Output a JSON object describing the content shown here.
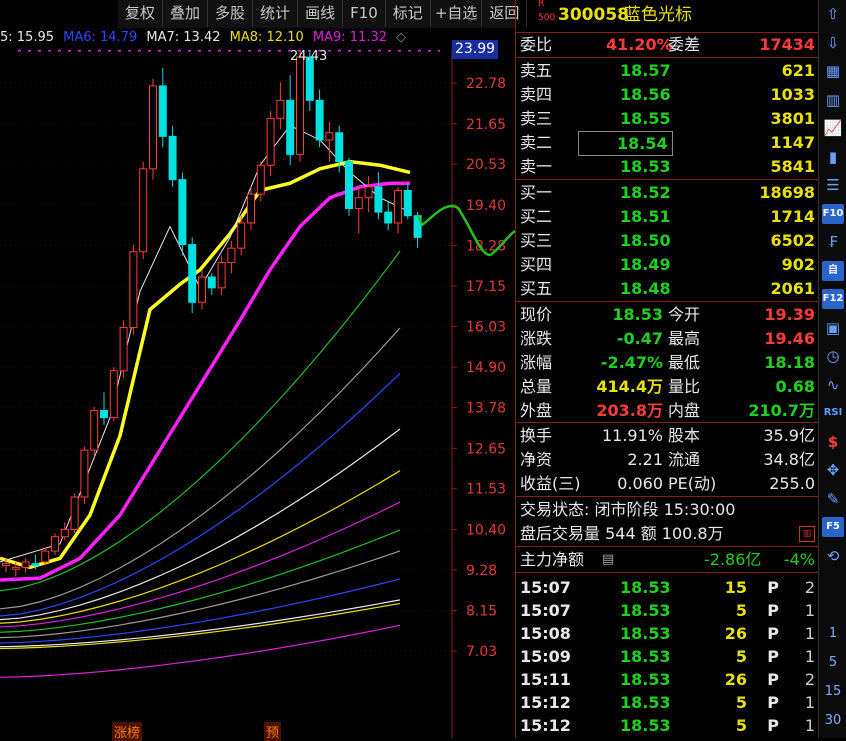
{
  "toolbar": {
    "items": [
      "复权",
      "叠加",
      "多股",
      "统计",
      "画线",
      "F10",
      "标记",
      "+自选",
      "返回"
    ]
  },
  "ma_legend": [
    {
      "label": "5: 15.95",
      "color": "#e8e8e8"
    },
    {
      "label": "MA6: 14.79",
      "color": "#2a48ff"
    },
    {
      "label": "MA7: 13.42",
      "color": "#e8e8e8"
    },
    {
      "label": "MA8: 12.10",
      "color": "#e8e000"
    },
    {
      "label": "MA9: 11.32",
      "color": "#e020e0"
    }
  ],
  "chart_data": {
    "type": "candlestick",
    "price_ticks": [
      "22.78",
      "21.65",
      "20.53",
      "19.40",
      "18.28",
      "17.15",
      "16.03",
      "14.90",
      "13.78",
      "12.65",
      "11.53",
      "10.40",
      "9.28",
      "8.15",
      "7.03"
    ],
    "current_price_tag": "23.99",
    "high_label": "24.43",
    "bottom_markers": [
      "涨榜",
      "预"
    ]
  },
  "stock": {
    "r_badge": "R",
    "market_code": "500",
    "code": "300058",
    "name": "蓝色光标"
  },
  "weibi": {
    "label1": "委比",
    "val1": "41.20%",
    "label2": "委差",
    "val2": "17434"
  },
  "sell": [
    {
      "label": "卖五",
      "price": "18.57",
      "vol": "621"
    },
    {
      "label": "卖四",
      "price": "18.56",
      "vol": "1033"
    },
    {
      "label": "卖三",
      "price": "18.55",
      "vol": "3801"
    },
    {
      "label": "卖二",
      "price": "18.54",
      "vol": "1147"
    },
    {
      "label": "卖一",
      "price": "18.53",
      "vol": "5841"
    }
  ],
  "buy": [
    {
      "label": "买一",
      "price": "18.52",
      "vol": "18698"
    },
    {
      "label": "买二",
      "price": "18.51",
      "vol": "1714"
    },
    {
      "label": "买三",
      "price": "18.50",
      "vol": "6502"
    },
    {
      "label": "买四",
      "price": "18.49",
      "vol": "902"
    },
    {
      "label": "买五",
      "price": "18.48",
      "vol": "2061"
    }
  ],
  "stats": [
    {
      "l1": "现价",
      "v1": "18.53",
      "c1": "green",
      "l2": "今开",
      "v2": "19.39",
      "c2": "red"
    },
    {
      "l1": "涨跌",
      "v1": "-0.47",
      "c1": "green",
      "l2": "最高",
      "v2": "19.46",
      "c2": "red"
    },
    {
      "l1": "涨幅",
      "v1": "-2.47%",
      "c1": "green",
      "l2": "最低",
      "v2": "18.18",
      "c2": "green"
    },
    {
      "l1": "总量",
      "v1": "414.4万",
      "c1": "yellow",
      "l2": "量比",
      "v2": "0.68",
      "c2": "green"
    },
    {
      "l1": "外盘",
      "v1": "203.8万",
      "c1": "red",
      "l2": "内盘",
      "v2": "210.7万",
      "c2": "green"
    }
  ],
  "fundamentals": [
    {
      "l1": "换手",
      "v1": "11.91%",
      "l2": "股本",
      "v2": "35.9亿"
    },
    {
      "l1": "净资",
      "v1": "2.21",
      "l2": "流通",
      "v2": "34.8亿"
    },
    {
      "l1": "收益(三)",
      "v1": "0.060",
      "l2": "PE(动)",
      "v2": "255.0"
    }
  ],
  "trade_status": "交易状态: 闭市阶段 15:30:00",
  "after_hours": "盘后交易量 544 额 100.8万",
  "main_force": {
    "label": "主力净额",
    "amount": "-2.86亿",
    "pct": "-4%"
  },
  "ticks": [
    {
      "time": "15:07",
      "price": "18.53",
      "vol": "15",
      "flag": "P",
      "n": "2"
    },
    {
      "time": "15:07",
      "price": "18.53",
      "vol": "5",
      "flag": "P",
      "n": "1"
    },
    {
      "time": "15:08",
      "price": "18.53",
      "vol": "26",
      "flag": "P",
      "n": "1"
    },
    {
      "time": "15:09",
      "price": "18.53",
      "vol": "5",
      "flag": "P",
      "n": "1"
    },
    {
      "time": "15:11",
      "price": "18.53",
      "vol": "26",
      "flag": "P",
      "n": "2"
    },
    {
      "time": "15:12",
      "price": "18.53",
      "vol": "5",
      "flag": "P",
      "n": "1"
    },
    {
      "time": "15:12",
      "price": "18.53",
      "vol": "5",
      "flag": "P",
      "n": "1"
    }
  ],
  "sidebar": {
    "period_labels": [
      "1",
      "5",
      "15",
      "30"
    ],
    "icons": [
      "up-arrow-icon",
      "down-arrow-icon",
      "report-icon",
      "table-icon",
      "line-chart-icon",
      "candle-chart-icon",
      "list-icon",
      "f10-icon",
      "finance-icon",
      "self-select-icon",
      "f12-icon",
      "calculator-icon",
      "clock-icon",
      "wave-icon",
      "rsi-icon",
      "dollar-icon",
      "move-icon",
      "pencil-icon",
      "f5-icon",
      "refresh-icon"
    ],
    "text_icons": {
      "f10": "F10",
      "self": "自",
      "f12": "F12",
      "rsi": "RSI",
      "dollar": "$",
      "f5": "F5"
    }
  }
}
